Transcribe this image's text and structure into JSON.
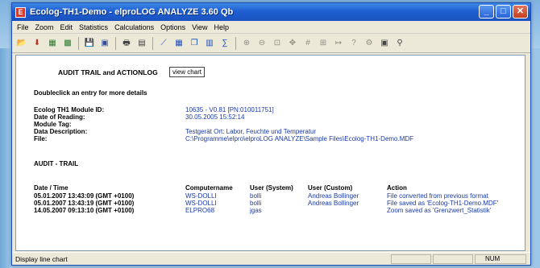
{
  "window": {
    "title": "Ecolog-TH1-Demo - elproLOG ANALYZE 3.60 Qb"
  },
  "menu": [
    "File",
    "Zoom",
    "Edit",
    "Statistics",
    "Calculations",
    "Options",
    "View",
    "Help"
  ],
  "header": {
    "section_title": "AUDIT TRAIL and ACTIONLOG",
    "view_chart_label": "view chart",
    "hint": "Doubleclick an entry for more details"
  },
  "info": [
    {
      "label": "Ecolog TH1 Module ID:",
      "value": "10635 - V0.81 [PN:010011751]"
    },
    {
      "label": "Date of Reading:",
      "value": "30.05.2005 15:52:14"
    },
    {
      "label": "Module Tag:",
      "value": ""
    },
    {
      "label": "Data Description:",
      "value": "Testgerät Ort: Labor, Feuchte und Temperatur"
    },
    {
      "label": "File:",
      "value": "C:\\Programme\\elpro\\elproLOG ANALYZE\\Sample Files\\Ecolog-TH1-Demo.MDF"
    }
  ],
  "audit": {
    "title": "AUDIT - TRAIL",
    "columns": [
      "Date / Time",
      "Computername",
      "User (System)",
      "User (Custom)",
      "Action"
    ],
    "rows": [
      [
        "05.01.2007 13:43:09 (GMT +0100)",
        "WS-DOLLI",
        "bolli",
        "Andreas Bollinger",
        "File converted from previous format"
      ],
      [
        "05.01.2007 13:43:19 (GMT +0100)",
        "WS-DOLLI",
        "bolli",
        "Andreas Bollinger",
        "File saved as 'Ecolog-TH1-Demo.MDF'"
      ],
      [
        "14.05.2007 09:13:10 (GMT +0100)",
        "ELPRO68",
        "jgas",
        "",
        "Zoom saved as 'Grenzwert_Statistik'"
      ]
    ]
  },
  "status": {
    "text": "Display line chart",
    "num": "NUM"
  },
  "icons": {
    "app": "app-icon",
    "toolbar": [
      "open-folder-icon",
      "download-icon",
      "chart-icon",
      "chart-alt-icon",
      "save-icon",
      "save-as-icon",
      "print-icon",
      "print-preview-icon",
      "line-chart-icon",
      "table-icon",
      "copy-icon",
      "paste-icon",
      "statistics-icon",
      "zoom-in-icon",
      "zoom-out-icon",
      "zoom-fit-icon",
      "pan-icon",
      "grid-icon",
      "marker-icon",
      "arrow-icon",
      "help-icon",
      "settings-icon",
      "info-icon"
    ]
  }
}
